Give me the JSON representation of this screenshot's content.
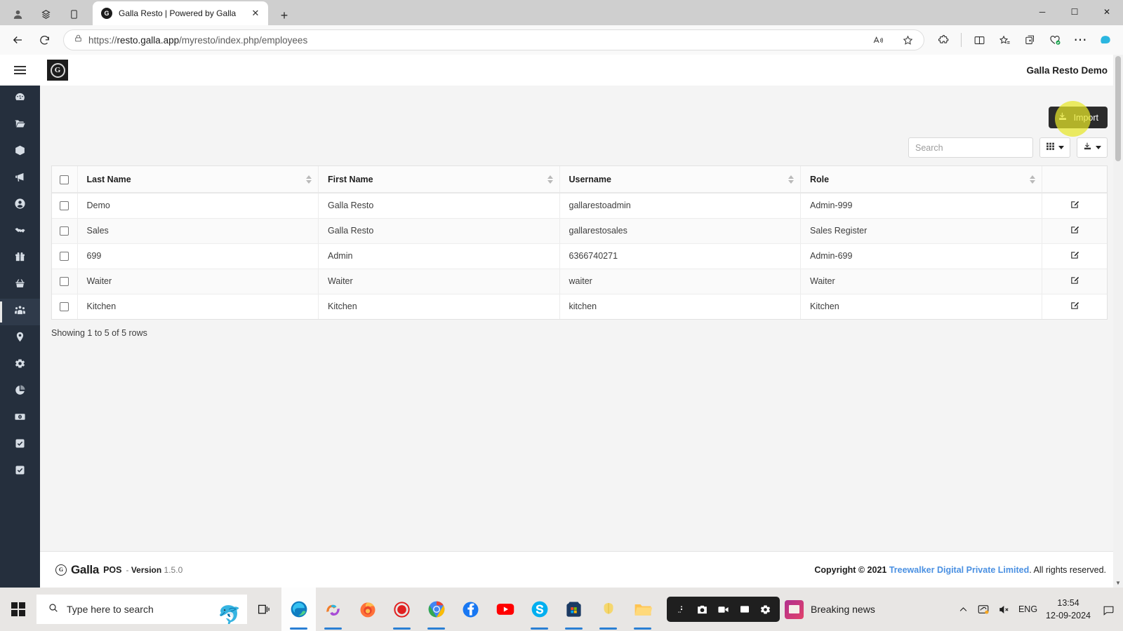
{
  "browser": {
    "tab": {
      "title": "Galla Resto | Powered by Galla",
      "favicon_label": "G",
      "close_icon": "✕"
    },
    "new_tab_label": "+",
    "toolbar_icons": {
      "profile": "profile-icon",
      "collections": "collections-icon",
      "split": "split-screen-icon",
      "back": "←",
      "reload": "⟳",
      "lock": "lock-icon",
      "read_aloud": "read-aloud-icon",
      "favorite": "star-icon",
      "extensions": "extensions-icon",
      "split_screen": "split-screen-icon",
      "favorites_bar": "favorites-list-icon",
      "collections2": "add-collection-icon",
      "browser_essentials": "browser-essentials-icon",
      "settings_more": "⋯",
      "copilot": "copilot-icon"
    },
    "url_prefix": "https://",
    "url_host": "resto.galla.app",
    "url_path": "/myresto/index.php/employees",
    "window_controls": {
      "minimize": "─",
      "maximize": "☐",
      "close": "✕"
    }
  },
  "app": {
    "logo_letter": "G",
    "menu_toggle": "hamburger-icon",
    "user_label": "Galla Resto Demo",
    "sidebar": [
      {
        "name": "dashboard",
        "icon": "gauge-icon"
      },
      {
        "name": "files",
        "icon": "folder-icon"
      },
      {
        "name": "inventory",
        "icon": "box-icon"
      },
      {
        "name": "marketing",
        "icon": "megaphone-icon"
      },
      {
        "name": "customers",
        "icon": "user-circle-icon"
      },
      {
        "name": "partners",
        "icon": "handshake-icon"
      },
      {
        "name": "offers",
        "icon": "gift-icon"
      },
      {
        "name": "orders",
        "icon": "basket-icon"
      },
      {
        "name": "employees",
        "icon": "people-icon",
        "active": true
      },
      {
        "name": "locations",
        "icon": "map-pin-icon"
      },
      {
        "name": "settings",
        "icon": "gear-icon"
      },
      {
        "name": "reports",
        "icon": "pie-chart-icon"
      },
      {
        "name": "payments",
        "icon": "cash-icon"
      },
      {
        "name": "tasks",
        "icon": "checkbox-icon"
      },
      {
        "name": "approvals",
        "icon": "checkbox-icon"
      }
    ],
    "toolbar": {
      "import_label": "Import",
      "import_icon": "import-icon",
      "search_placeholder": "Search",
      "search_value": "",
      "columns_icon": "grid-columns-icon",
      "export_icon": "export-icon",
      "caret_icon": "chevron-down-icon"
    },
    "table": {
      "columns": [
        "Last Name",
        "First Name",
        "Username",
        "Role"
      ],
      "rows": [
        {
          "last_name": "Demo",
          "first_name": "Galla Resto",
          "username": "gallarestoadmin",
          "role": "Admin-999"
        },
        {
          "last_name": "Sales",
          "first_name": "Galla Resto",
          "username": "gallarestosales",
          "role": "Sales Register"
        },
        {
          "last_name": "699",
          "first_name": "Admin",
          "username": "6366740271",
          "role": "Admin-699"
        },
        {
          "last_name": "Waiter",
          "first_name": "Waiter",
          "username": "waiter",
          "role": "Waiter"
        },
        {
          "last_name": "Kitchen",
          "first_name": "Kitchen",
          "username": "kitchen",
          "role": "Kitchen"
        }
      ],
      "edit_icon": "edit-pencil-icon",
      "showing_text": "Showing 1 to 5 of 5 rows"
    },
    "footer": {
      "logo_letter": "G",
      "brand": "Galla",
      "product": "POS",
      "dash": "-",
      "version_label": "Version",
      "version_number": "1.5.0",
      "copyright_prefix": "Copyright © 2021",
      "company": "Treewalker Digital Private Limited",
      "copyright_suffix": ". All rights reserved.",
      "link_color": "#4a90e2"
    }
  },
  "taskbar": {
    "start_icon": "windows-start-icon",
    "search_placeholder": "Type here to search",
    "search_pet_icon": "dolphin-icon",
    "task_view_icon": "task-view-icon",
    "apps": [
      {
        "name": "microsoft-edge",
        "icon": "edge-icon"
      },
      {
        "name": "copilot",
        "icon": "copilot-icon"
      },
      {
        "name": "firefox",
        "icon": "firefox-icon"
      },
      {
        "name": "screen-recorder",
        "icon": "record-icon"
      },
      {
        "name": "google-chrome",
        "icon": "chrome-icon"
      },
      {
        "name": "facebook",
        "icon": "facebook-icon"
      },
      {
        "name": "youtube",
        "icon": "youtube-icon"
      },
      {
        "name": "skype",
        "icon": "skype-icon"
      },
      {
        "name": "microsoft-store",
        "icon": "store-icon"
      },
      {
        "name": "tulip-app",
        "icon": "tulip-icon"
      },
      {
        "name": "file-explorer",
        "icon": "folder-icon"
      }
    ],
    "capture_bar": [
      "screenshot-camera-icon",
      "video-record-icon",
      "window-capture-icon",
      "capture-settings-icon"
    ],
    "news_label": "Breaking news",
    "tray": {
      "chevron": "chevron-up-icon",
      "onedrive": "onedrive-icon",
      "volume": "volume-muted-icon",
      "language": "ENG",
      "time": "13:54",
      "date": "12-09-2024",
      "notifications": "notification-icon"
    }
  }
}
